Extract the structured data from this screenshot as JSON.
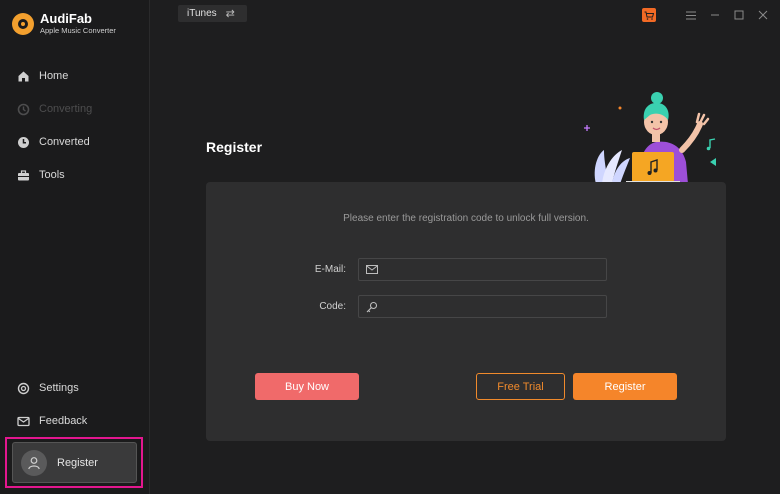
{
  "app": {
    "name": "AudiFab",
    "subtitle": "Apple Music Converter"
  },
  "topbar": {
    "source_label": "iTunes",
    "switch_glyph": "⇄"
  },
  "sidebar": {
    "items": [
      {
        "label": "Home",
        "icon": "home-icon",
        "enabled": true
      },
      {
        "label": "Converting",
        "icon": "converting-icon",
        "enabled": false
      },
      {
        "label": "Converted",
        "icon": "clock-icon",
        "enabled": true
      },
      {
        "label": "Tools",
        "icon": "toolbox-icon",
        "enabled": true
      }
    ],
    "bottom": [
      {
        "label": "Settings",
        "icon": "gear-icon"
      },
      {
        "label": "Feedback",
        "icon": "mail-icon"
      }
    ],
    "register_label": "Register"
  },
  "main": {
    "title": "Register",
    "hint": "Please enter the registration code to unlock full version.",
    "email_label": "E-Mail:",
    "email_value": "",
    "code_label": "Code:",
    "code_value": "",
    "buy_now": "Buy Now",
    "free_trial": "Free Trial",
    "register": "Register"
  },
  "colors": {
    "accent": "#f5852a",
    "buy_button": "#f06a6a",
    "highlight_border": "#e3178f",
    "logo": "#f3a02e"
  }
}
